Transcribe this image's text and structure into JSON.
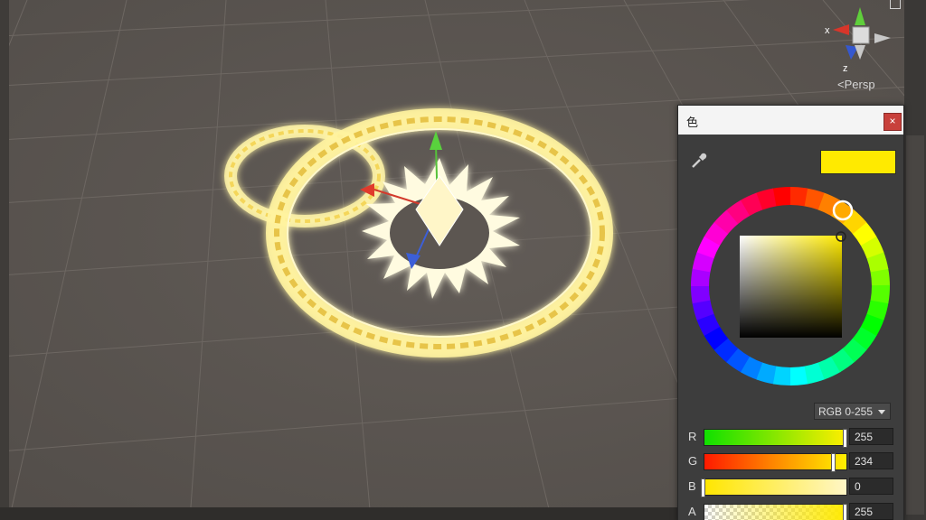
{
  "gizmo": {
    "x_axis": "x",
    "z_axis": "z",
    "projection": "Persp"
  },
  "color_picker": {
    "title": "色",
    "close": "×",
    "current_color": "#FFEA00",
    "mode": "RGB 0-255",
    "channels": [
      {
        "label": "R",
        "value": "255",
        "fraction": 1.0
      },
      {
        "label": "G",
        "value": "234",
        "fraction": 0.918
      },
      {
        "label": "B",
        "value": "0",
        "fraction": 0.0
      },
      {
        "label": "A",
        "value": "255",
        "fraction": 1.0
      }
    ]
  },
  "colors": {
    "accent_yellow": "#FFEA00",
    "close_red": "#C8403B",
    "scene_bg": "#5B5651"
  }
}
